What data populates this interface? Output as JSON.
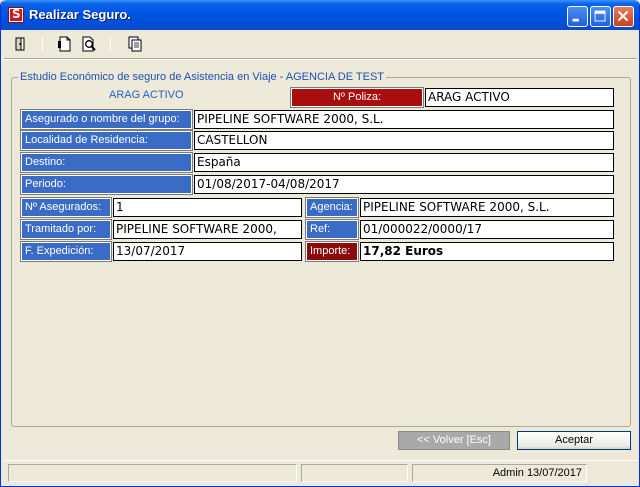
{
  "window": {
    "title": "Realizar Seguro.",
    "app_icon_letter": "S"
  },
  "toolbar": {
    "icons": [
      "exit-door-icon",
      "new-document-icon",
      "print-preview-icon",
      "copy-pages-icon"
    ]
  },
  "group": {
    "legend": "Estudio Económico de seguro de Asistencia en Viaje - AGENCIA DE TEST",
    "subtitle": "ARAG ACTIVO"
  },
  "form": {
    "poliza": {
      "label": "Nº Poliza:",
      "value": "ARAG ACTIVO"
    },
    "asegurado": {
      "label": "Asegurado o nombre del grupo:",
      "value": "PIPELINE SOFTWARE 2000, S.L."
    },
    "localidad": {
      "label": "Localidad de Residencia:",
      "value": "CASTELLON"
    },
    "destino": {
      "label": "Destino:",
      "value": "España"
    },
    "periodo": {
      "label": "Periodo:",
      "value": "01/08/2017-04/08/2017"
    },
    "num_asegurados": {
      "label": "Nº Asegurados:",
      "value": "1"
    },
    "agencia": {
      "label": "Agencia:",
      "value": "PIPELINE SOFTWARE 2000, S.L."
    },
    "tramitado": {
      "label": "Tramitado por:",
      "value": "PIPELINE SOFTWARE 2000,"
    },
    "ref": {
      "label": "Ref:",
      "value": "01/000022/0000/17"
    },
    "expedicion": {
      "label": "F. Expedición:",
      "value": "13/07/2017"
    },
    "importe": {
      "label": "Importe:",
      "value": "17,82 Euros"
    }
  },
  "buttons": {
    "volver": "<< Volver  [Esc]",
    "aceptar": "Aceptar"
  },
  "statusbar": {
    "panel1": "",
    "panel2": "",
    "panel3": "Admin 13/07/2017"
  },
  "colors": {
    "label_blue": "#3A6CC6",
    "label_red": "#A80E0E",
    "titlebar_blue": "#0055E5"
  }
}
